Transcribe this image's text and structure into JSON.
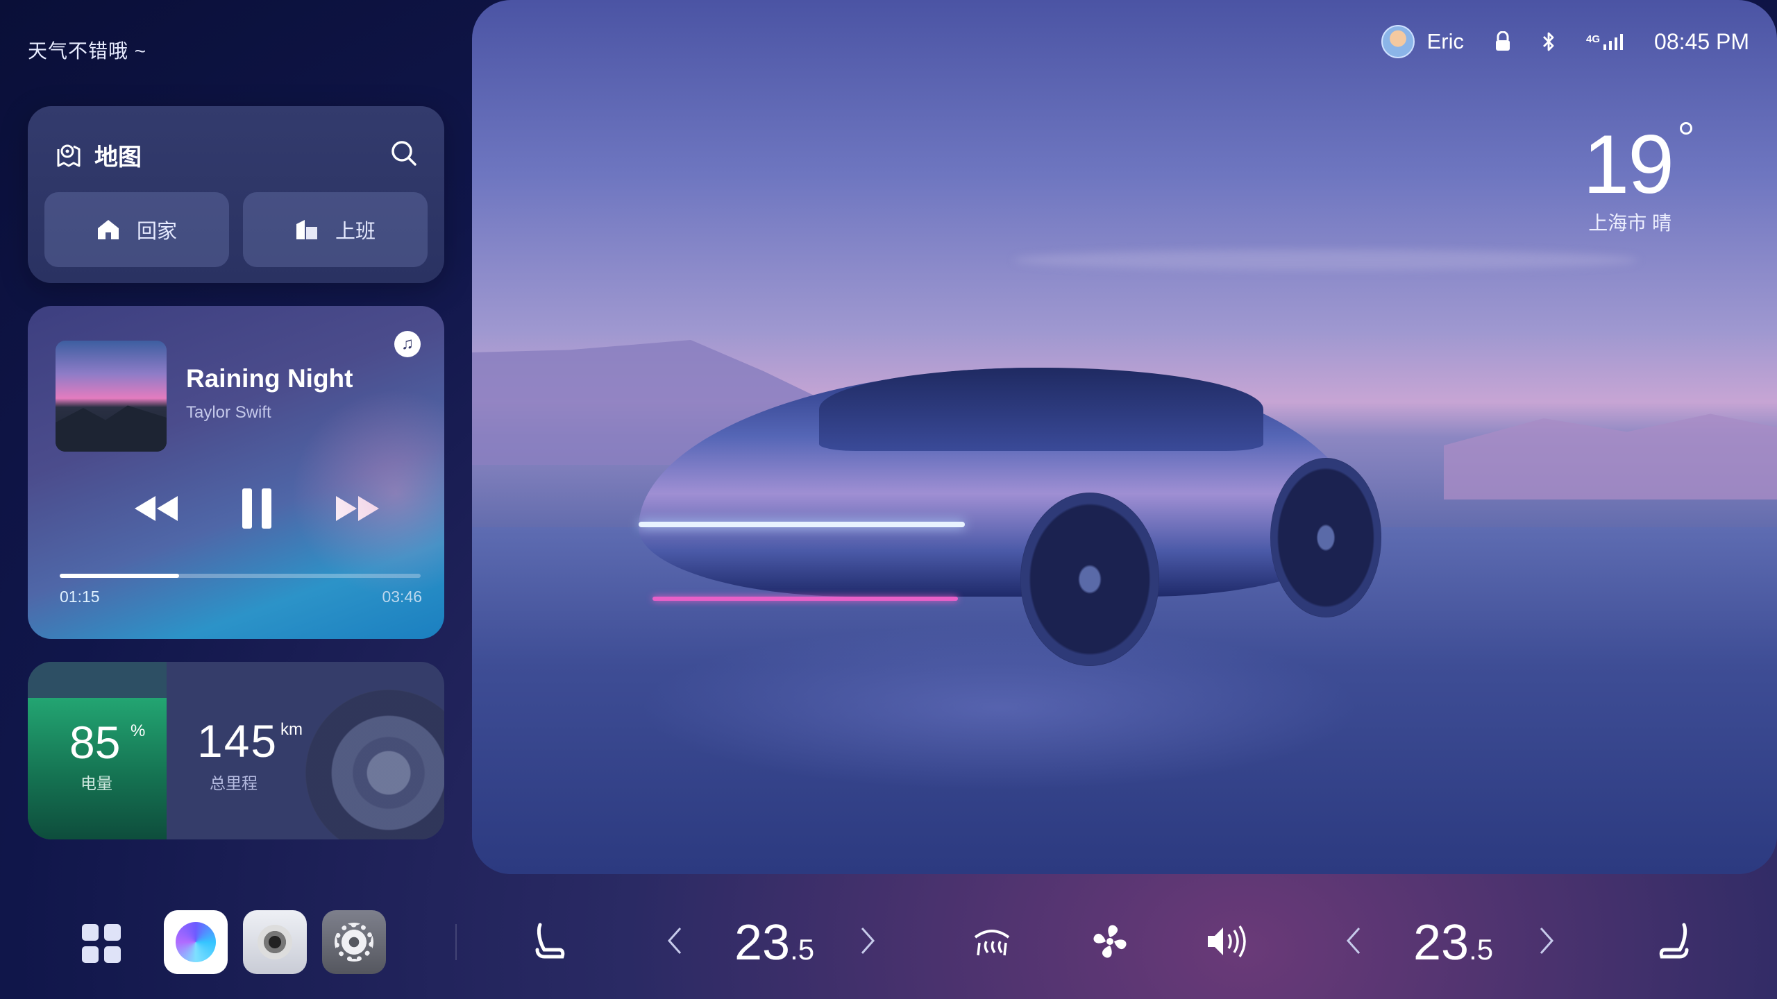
{
  "greeting": "天气不错哦 ~",
  "map": {
    "title": "地图",
    "home_label": "回家",
    "work_label": "上班"
  },
  "music": {
    "title": "Raining Night",
    "artist": "Taylor Swift",
    "current_time": "01:15",
    "total_time": "03:46",
    "progress": 0.33
  },
  "stats": {
    "battery_value": "85",
    "battery_unit": "%",
    "battery_label": "电量",
    "range_value": "145",
    "range_unit": "km",
    "range_label": "总里程"
  },
  "status_bar": {
    "user_name": "Eric",
    "network": "4G",
    "time": "08:45 PM"
  },
  "weather": {
    "temperature": "19",
    "location": "上海市 晴"
  },
  "climate": {
    "left_temp_whole": "23",
    "left_temp_decimal": ".5",
    "right_temp_whole": "23",
    "right_temp_decimal": ".5"
  },
  "colors": {
    "accent_progress": "#ffffff",
    "battery_green": "#23a572",
    "car_trim_pink": "#e860c8"
  }
}
